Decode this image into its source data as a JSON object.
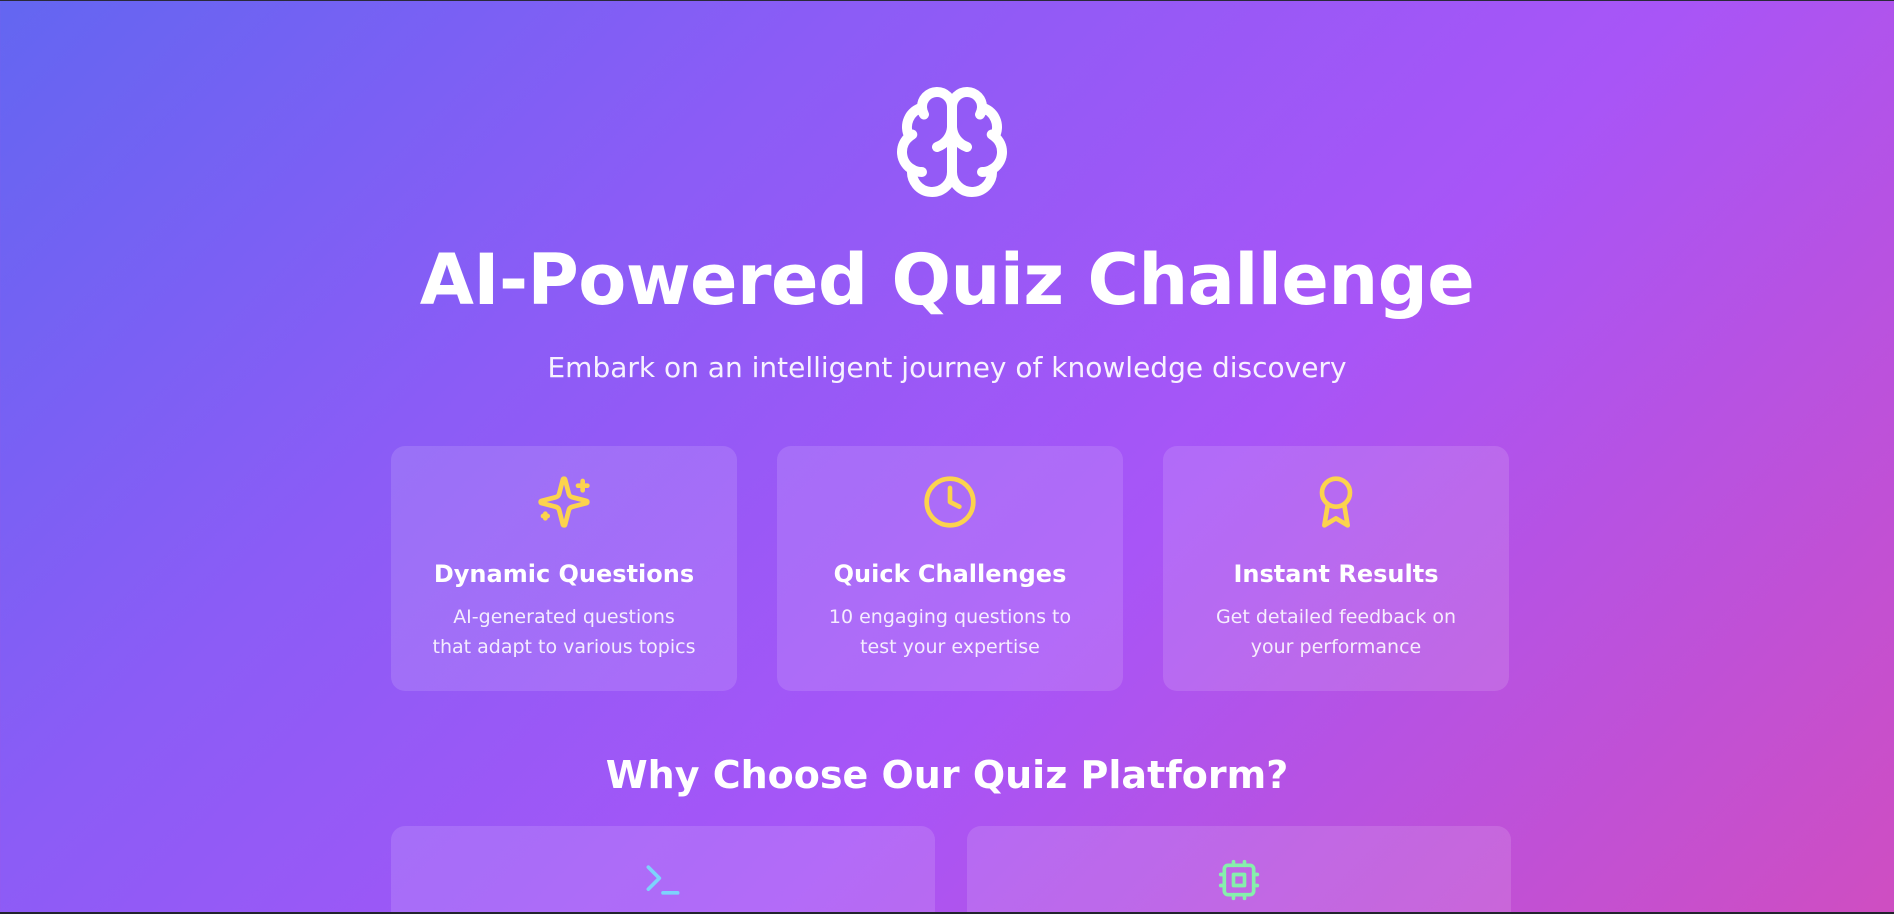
{
  "hero": {
    "icon": "brain-icon",
    "title": "AI-Powered Quiz Challenge",
    "subtitle": "Embark on an intelligent journey of knowledge discovery"
  },
  "features": [
    {
      "icon": "sparkles-icon",
      "title": "Dynamic Questions",
      "description": "AI-generated questions that adapt to various topics"
    },
    {
      "icon": "clock-icon",
      "title": "Quick Challenges",
      "description": "10 engaging questions to test your expertise"
    },
    {
      "icon": "award-icon",
      "title": "Instant Results",
      "description": "Get detailed feedback on your performance"
    }
  ],
  "why_section": {
    "title": "Why Choose Our Quiz Platform?",
    "cards": [
      {
        "icon": "terminal-icon"
      },
      {
        "icon": "cpu-icon"
      }
    ]
  },
  "colors": {
    "accent_yellow": "#fcd34d",
    "terminal_blue": "#7dd3fc",
    "cpu_green": "#86efac"
  }
}
